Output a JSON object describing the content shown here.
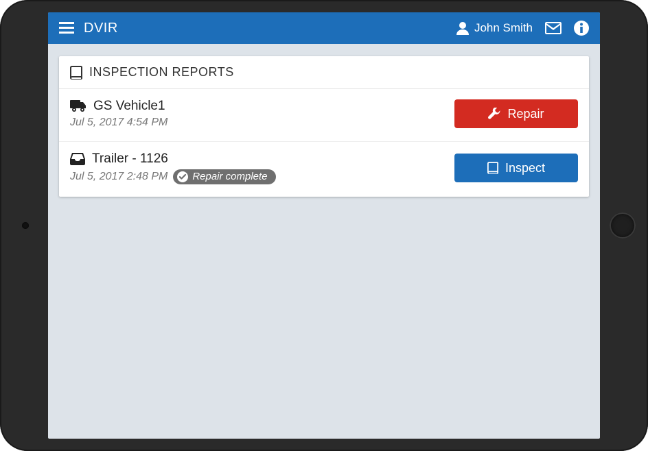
{
  "header": {
    "title": "DVIR",
    "user_name": "John Smith"
  },
  "card": {
    "title": "INSPECTION REPORTS"
  },
  "reports": [
    {
      "icon": "truck",
      "name": "GS Vehicle1",
      "timestamp": "Jul 5, 2017 4:54 PM",
      "status": null,
      "action_label": "Repair",
      "action_type": "repair"
    },
    {
      "icon": "inbox",
      "name": "Trailer - 1126",
      "timestamp": "Jul 5, 2017 2:48 PM",
      "status": "Repair complete",
      "action_label": "Inspect",
      "action_type": "inspect"
    }
  ],
  "colors": {
    "brand": "#1d6eb9",
    "repair": "#d32b21",
    "inspect": "#1d6eb9",
    "pill": "#6f6f6f"
  }
}
